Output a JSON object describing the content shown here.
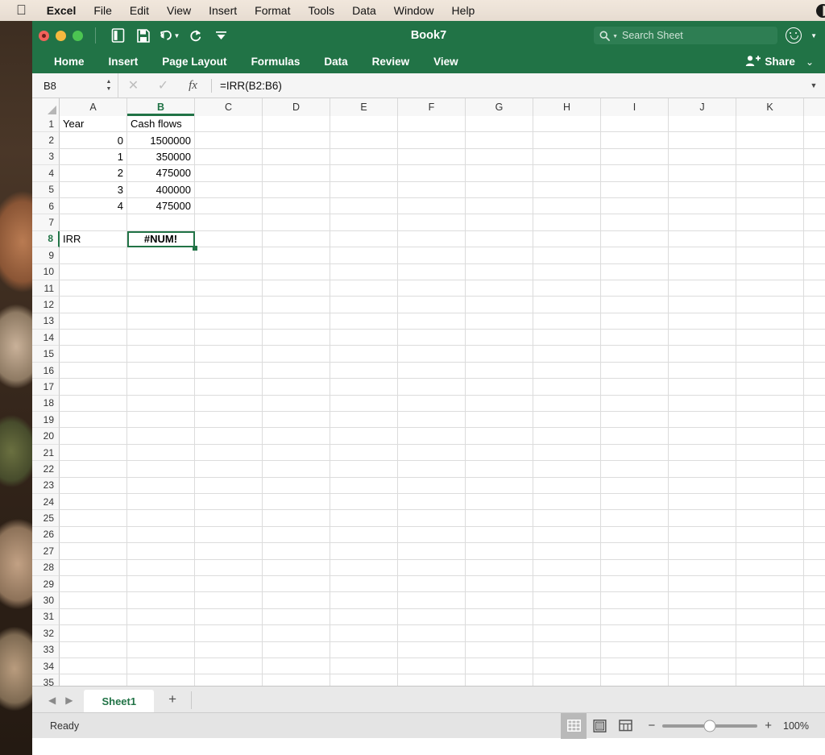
{
  "menubar": {
    "apple_icon": "apple-logo-icon",
    "items": [
      "Excel",
      "File",
      "Edit",
      "View",
      "Insert",
      "Format",
      "Tools",
      "Data",
      "Window",
      "Help"
    ],
    "right_icon": "control-center-icon"
  },
  "titlebar": {
    "title": "Book7",
    "traffic_lights": [
      "close",
      "minimize",
      "zoom"
    ],
    "quick_access": [
      "new-document-icon",
      "save-icon",
      "undo-icon",
      "redo-icon",
      "customize-toolbar-icon"
    ],
    "search_placeholder": "Search Sheet",
    "search_icon": "search-icon",
    "smiley_icon": "smiley-face-icon"
  },
  "ribbon": {
    "tabs": [
      "Home",
      "Insert",
      "Page Layout",
      "Formulas",
      "Data",
      "Review",
      "View"
    ],
    "active_tab": "Home",
    "share_label": "Share",
    "share_icon": "person-add-icon"
  },
  "formula_bar": {
    "name_box": "B8",
    "cancel_icon": "cancel-x-icon",
    "confirm_icon": "confirm-check-icon",
    "fx_icon": "fx-icon",
    "formula": "=IRR(B2:B6)"
  },
  "grid": {
    "columns": [
      "A",
      "B",
      "C",
      "D",
      "E",
      "F",
      "G",
      "H",
      "I",
      "J",
      "K"
    ],
    "selected_column": "B",
    "rows": [
      1,
      2,
      3,
      4,
      5,
      6,
      7,
      8,
      9,
      10,
      11,
      12,
      13,
      14,
      15,
      16,
      17,
      18,
      19,
      20,
      21,
      22,
      23,
      24,
      25,
      26,
      27,
      28,
      29,
      30,
      31,
      32,
      33,
      34,
      35
    ],
    "selected_row": 8,
    "selected_cell": "B8",
    "cells": {
      "A1": "Year",
      "B1": "Cash flows",
      "A2": "0",
      "B2": "1500000",
      "A3": "1",
      "B3": "350000",
      "A4": "2",
      "B4": "475000",
      "A5": "3",
      "B5": "400000",
      "A6": "4",
      "B6": "475000",
      "A8": "IRR",
      "B8": "#NUM!"
    }
  },
  "sheetbar": {
    "prev_icon": "prev-sheet-icon",
    "next_icon": "next-sheet-icon",
    "tabs": [
      "Sheet1"
    ],
    "active_tab": "Sheet1",
    "add_label": "+"
  },
  "statusbar": {
    "status_text": "Ready",
    "views": [
      "normal-view-icon",
      "page-layout-view-icon",
      "page-break-view-icon"
    ],
    "active_view": "normal-view-icon",
    "zoom_out": "−",
    "zoom_in": "+",
    "zoom_level": "100%"
  },
  "colors": {
    "excel_green": "#217346",
    "titlebar_green": "#217346",
    "selection_green": "#217346"
  }
}
